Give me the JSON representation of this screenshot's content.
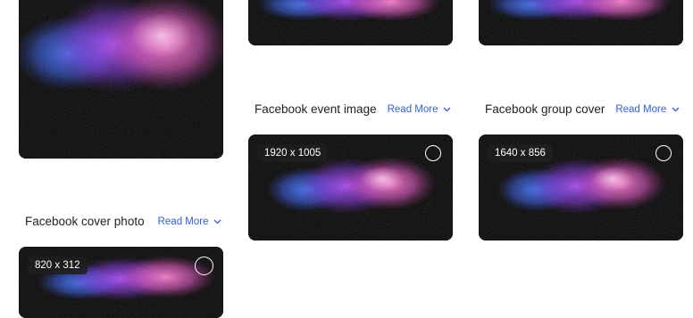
{
  "sections": [
    {
      "title": "Facebook event image",
      "read_more": "Read More",
      "dimensions": "1920 x 1005"
    },
    {
      "title": "Facebook group cover",
      "read_more": "Read More",
      "dimensions": "1640 x 856"
    },
    {
      "title": "Facebook cover photo",
      "read_more": "Read More",
      "dimensions": "820 x 312"
    }
  ],
  "icons": {
    "chevron": "chevron-down-icon",
    "select": "select-circle-icon"
  },
  "colors": {
    "link": "#2f5fd6",
    "card_bg": "#000000",
    "accent_pink": "#e04fbf",
    "accent_blue": "#2b6cff"
  }
}
